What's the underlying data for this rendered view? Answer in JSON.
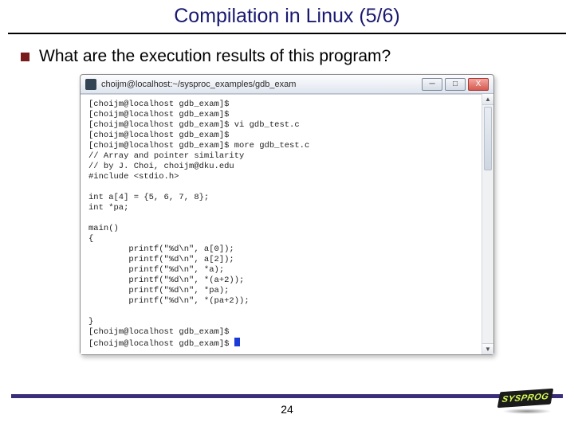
{
  "title": "Compilation in Linux (5/6)",
  "bullet": "What are the execution results of this program?",
  "page_number": "24",
  "logo_text": "SYSPROG",
  "window": {
    "title_text": "choijm@localhost:~/sysproc_examples/gdb_exam",
    "btn_min": "─",
    "btn_max": "□",
    "btn_close": "X",
    "sb_up": "▲",
    "sb_down": "▼"
  },
  "terminal": {
    "l01": "[choijm@localhost gdb_exam]$",
    "l02": "[choijm@localhost gdb_exam]$",
    "l03": "[choijm@localhost gdb_exam]$ vi gdb_test.c",
    "l04": "[choijm@localhost gdb_exam]$",
    "l05": "[choijm@localhost gdb_exam]$ more gdb_test.c",
    "l06": "// Array and pointer similarity",
    "l07": "// by J. Choi, choijm@dku.edu",
    "l08": "#include <stdio.h>",
    "l09": "",
    "l10": "int a[4] = {5, 6, 7, 8};",
    "l11": "int *pa;",
    "l12": "",
    "l13": "main()",
    "l14": "{",
    "l15": "        printf(\"%d\\n\", a[0]);",
    "l16": "        printf(\"%d\\n\", a[2]);",
    "l17": "        printf(\"%d\\n\", *a);",
    "l18": "        printf(\"%d\\n\", *(a+2));",
    "l19": "        printf(\"%d\\n\", *pa);",
    "l20": "        printf(\"%d\\n\", *(pa+2));",
    "l21": "",
    "l22": "}",
    "l23": "[choijm@localhost gdb_exam]$",
    "l24": "[choijm@localhost gdb_exam]$ "
  }
}
